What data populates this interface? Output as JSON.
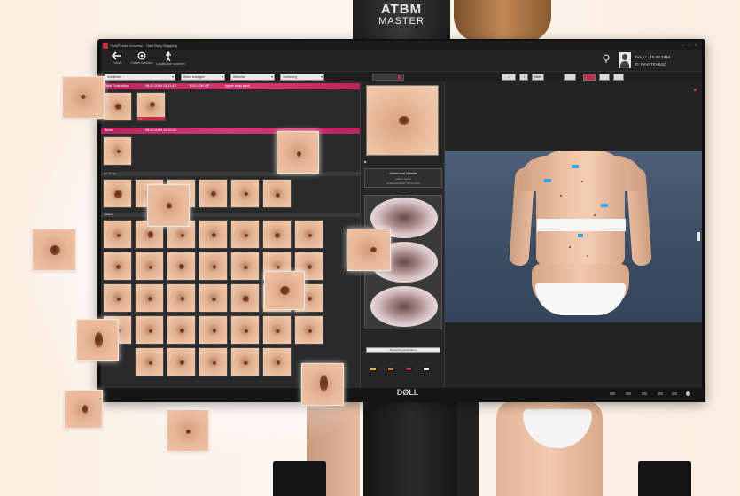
{
  "scene": {
    "device_top_label": "ATBM",
    "device_label": "MASTER",
    "monitor_brand": "DØLL"
  },
  "app": {
    "window_title": "FotoFinder Universe - Total Body Mapping",
    "window_controls": "– ▫ ×"
  },
  "toolbar": {
    "buttons": [
      {
        "label": "Zurück",
        "icon": "back-arrow-icon"
      },
      {
        "label": "Patient scannen",
        "icon": "scan-icon"
      },
      {
        "label": "Lokalisation scannen",
        "icon": "body-scan-icon"
      }
    ],
    "patient_name": "Eva, U · 15.08.1994",
    "patient_id": "ID: PeVATEAB4Z"
  },
  "filters": {
    "dropdowns": [
      {
        "value": "Alle Bilder"
      },
      {
        "value": "Bilder anzeigen"
      },
      {
        "value": "Bildreihe"
      },
      {
        "value": "Sortierung"
      }
    ],
    "right_tools": [
      "↔",
      "↕",
      "Mehr",
      "",
      "",
      "",
      ""
    ]
  },
  "groups": [
    {
      "title": "Total Evaluation",
      "date": "08.02.2019 13:11:43",
      "tag": "FOLLOW UP",
      "extra": "upper body back"
    },
    {
      "title": "Bilder",
      "date": "08.02.2019 13:10:32"
    }
  ],
  "sub_headers": [
    "unmarked",
    "marked"
  ],
  "thumb_captions": [
    "",
    "1 ×",
    "ältere Bilder"
  ],
  "middle": {
    "box_title": "Muttermal Details",
    "box_lines": [
      "Datum  12.03",
      "Aufnahmedatum  08.02.2019"
    ],
    "button_label": "Behandlungsaufnahme",
    "swatch_colors": [
      "#f2b81f",
      "#e8772e",
      "#c22e45",
      "#eeeeee"
    ]
  },
  "accent_color": "#c22e45"
}
